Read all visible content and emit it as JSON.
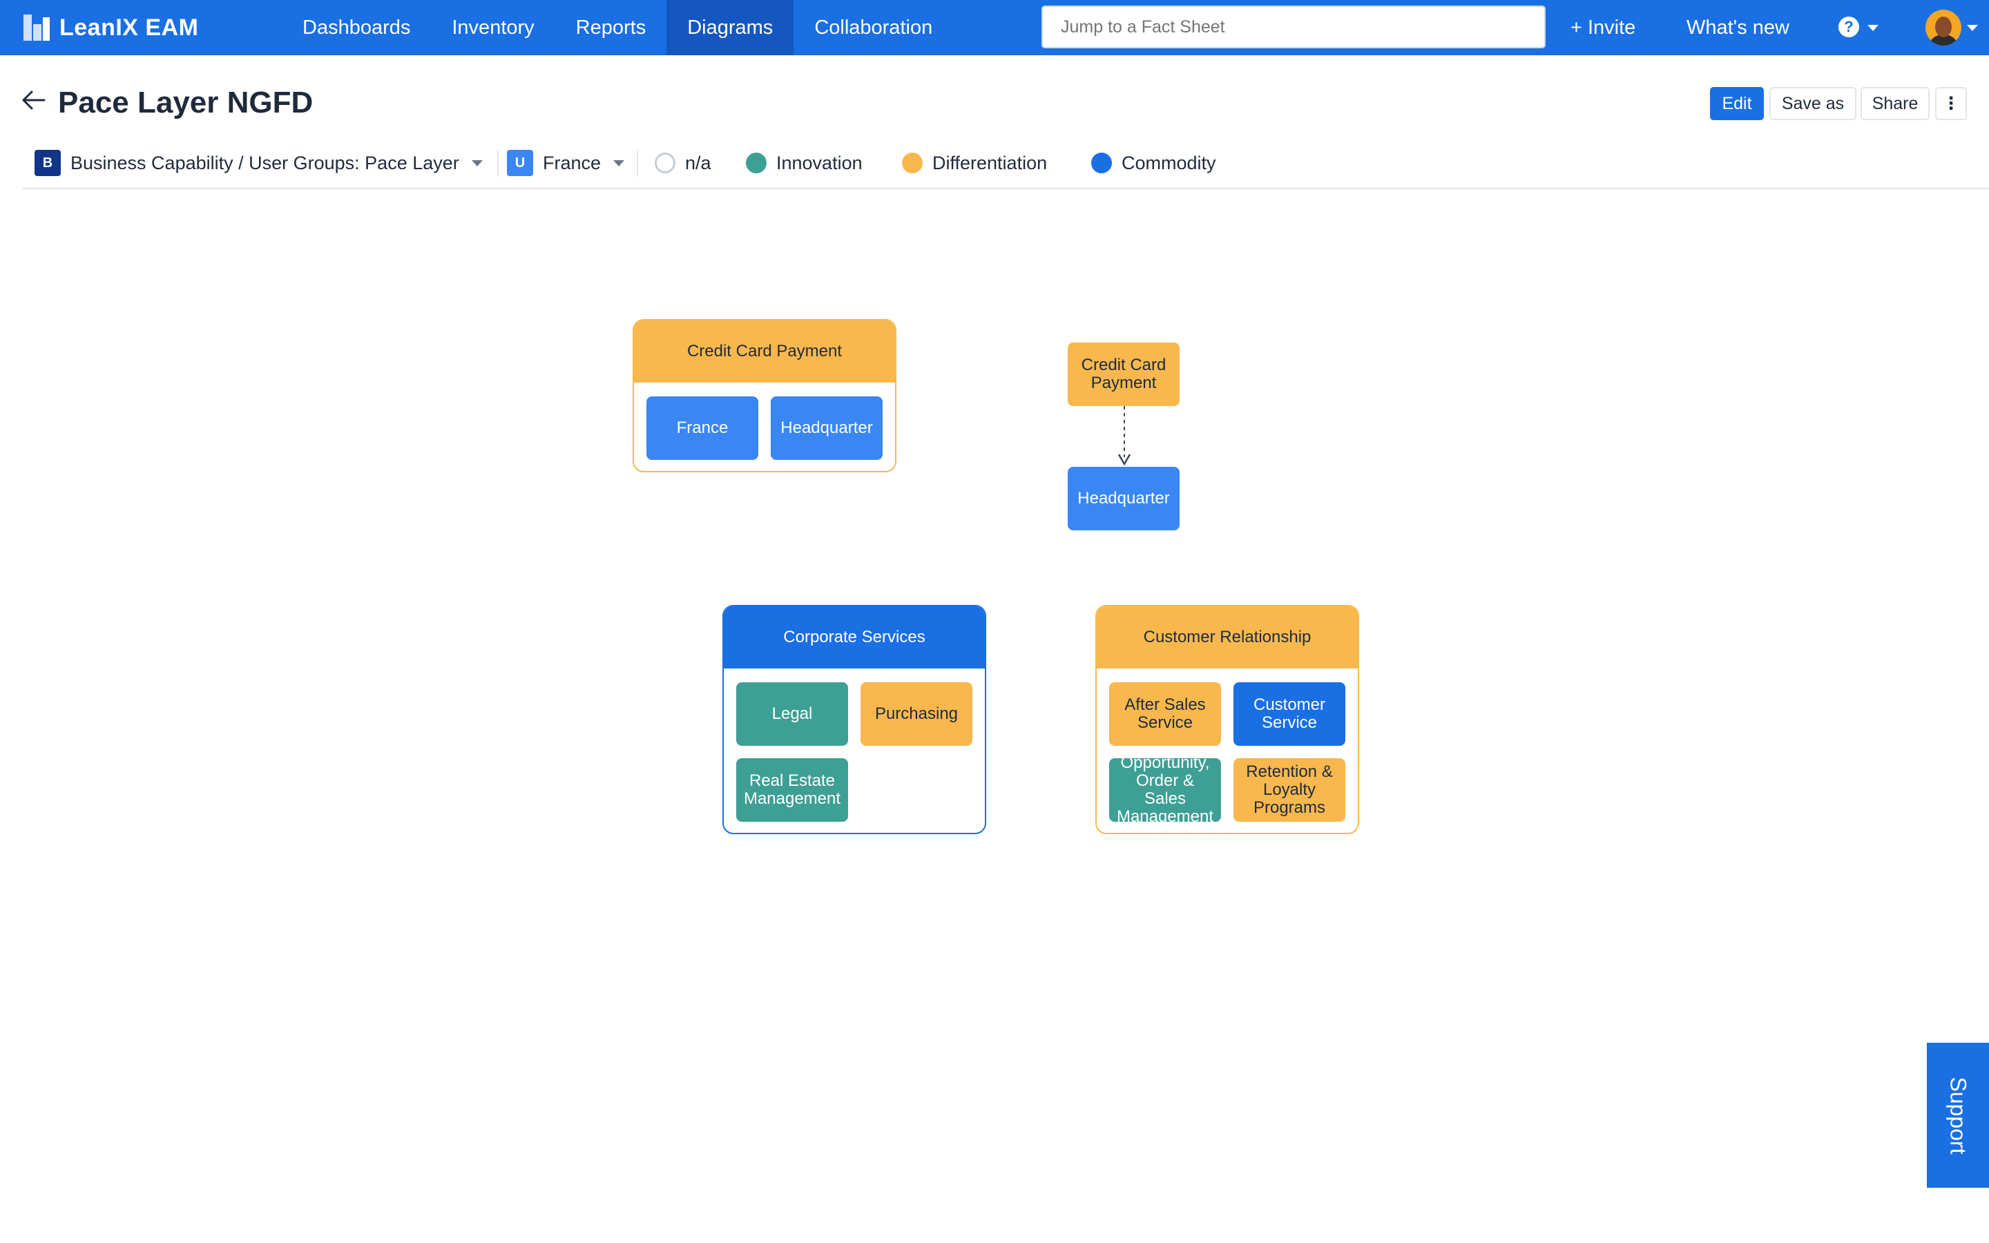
{
  "app": {
    "name": "LeanIX EAM"
  },
  "nav": {
    "items": [
      "Dashboards",
      "Inventory",
      "Reports",
      "Diagrams",
      "Collaboration"
    ],
    "active": "Diagrams"
  },
  "search": {
    "placeholder": "Jump to a Fact Sheet"
  },
  "topbar": {
    "invite": "+ Invite",
    "whats_new": "What's new",
    "help_icon": "question-icon",
    "help": "?"
  },
  "page": {
    "title": "Pace Layer NGFD"
  },
  "actions": {
    "edit": "Edit",
    "save_as": "Save as",
    "share": "Share",
    "more": "⋮"
  },
  "filters": {
    "view": {
      "badge": "B",
      "label": "Business Capability / User Groups: Pace Layer"
    },
    "user_group": {
      "badge": "U",
      "label": "France"
    },
    "legend": [
      {
        "label": "n/a",
        "color": "#ffffff"
      },
      {
        "label": "Innovation",
        "color": "#3e9f95"
      },
      {
        "label": "Differentiation",
        "color": "#f8b84e"
      },
      {
        "label": "Commodity",
        "color": "#1a6fe3"
      }
    ]
  },
  "diagram": {
    "group_ccp": {
      "title": "Credit Card Payment",
      "items": [
        "France",
        "Headquarter"
      ]
    },
    "relation": {
      "source": "Credit Card Payment",
      "target": "Headquarter"
    },
    "group_corp": {
      "title": "Corporate Services",
      "items": [
        "Legal",
        "Purchasing",
        "Real Estate Management"
      ]
    },
    "group_cust": {
      "title": "Customer Relationship",
      "items": [
        "After Sales Service",
        "Customer Service",
        "Opportunity, Order & Sales Management",
        "Retention & Loyalty Programs"
      ]
    }
  },
  "support": {
    "label": "Support"
  },
  "colors": {
    "brand": "#1a6fe3",
    "innovation": "#3e9f95",
    "differentiation": "#f8b84e",
    "commodity": "#1a6fe3"
  }
}
